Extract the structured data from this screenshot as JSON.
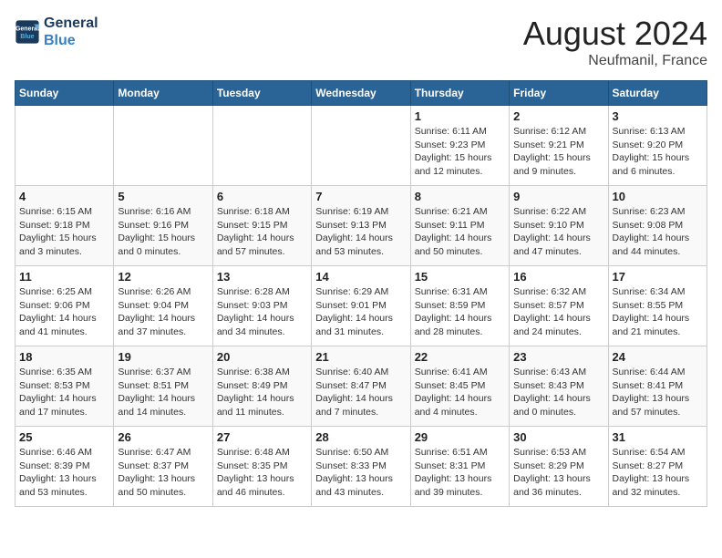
{
  "header": {
    "logo_line1": "General",
    "logo_line2": "Blue",
    "title": "August 2024",
    "subtitle": "Neufmanil, France"
  },
  "days_of_week": [
    "Sunday",
    "Monday",
    "Tuesday",
    "Wednesday",
    "Thursday",
    "Friday",
    "Saturday"
  ],
  "weeks": [
    [
      {
        "day": "",
        "info": ""
      },
      {
        "day": "",
        "info": ""
      },
      {
        "day": "",
        "info": ""
      },
      {
        "day": "",
        "info": ""
      },
      {
        "day": "1",
        "info": "Sunrise: 6:11 AM\nSunset: 9:23 PM\nDaylight: 15 hours\nand 12 minutes."
      },
      {
        "day": "2",
        "info": "Sunrise: 6:12 AM\nSunset: 9:21 PM\nDaylight: 15 hours\nand 9 minutes."
      },
      {
        "day": "3",
        "info": "Sunrise: 6:13 AM\nSunset: 9:20 PM\nDaylight: 15 hours\nand 6 minutes."
      }
    ],
    [
      {
        "day": "4",
        "info": "Sunrise: 6:15 AM\nSunset: 9:18 PM\nDaylight: 15 hours\nand 3 minutes."
      },
      {
        "day": "5",
        "info": "Sunrise: 6:16 AM\nSunset: 9:16 PM\nDaylight: 15 hours\nand 0 minutes."
      },
      {
        "day": "6",
        "info": "Sunrise: 6:18 AM\nSunset: 9:15 PM\nDaylight: 14 hours\nand 57 minutes."
      },
      {
        "day": "7",
        "info": "Sunrise: 6:19 AM\nSunset: 9:13 PM\nDaylight: 14 hours\nand 53 minutes."
      },
      {
        "day": "8",
        "info": "Sunrise: 6:21 AM\nSunset: 9:11 PM\nDaylight: 14 hours\nand 50 minutes."
      },
      {
        "day": "9",
        "info": "Sunrise: 6:22 AM\nSunset: 9:10 PM\nDaylight: 14 hours\nand 47 minutes."
      },
      {
        "day": "10",
        "info": "Sunrise: 6:23 AM\nSunset: 9:08 PM\nDaylight: 14 hours\nand 44 minutes."
      }
    ],
    [
      {
        "day": "11",
        "info": "Sunrise: 6:25 AM\nSunset: 9:06 PM\nDaylight: 14 hours\nand 41 minutes."
      },
      {
        "day": "12",
        "info": "Sunrise: 6:26 AM\nSunset: 9:04 PM\nDaylight: 14 hours\nand 37 minutes."
      },
      {
        "day": "13",
        "info": "Sunrise: 6:28 AM\nSunset: 9:03 PM\nDaylight: 14 hours\nand 34 minutes."
      },
      {
        "day": "14",
        "info": "Sunrise: 6:29 AM\nSunset: 9:01 PM\nDaylight: 14 hours\nand 31 minutes."
      },
      {
        "day": "15",
        "info": "Sunrise: 6:31 AM\nSunset: 8:59 PM\nDaylight: 14 hours\nand 28 minutes."
      },
      {
        "day": "16",
        "info": "Sunrise: 6:32 AM\nSunset: 8:57 PM\nDaylight: 14 hours\nand 24 minutes."
      },
      {
        "day": "17",
        "info": "Sunrise: 6:34 AM\nSunset: 8:55 PM\nDaylight: 14 hours\nand 21 minutes."
      }
    ],
    [
      {
        "day": "18",
        "info": "Sunrise: 6:35 AM\nSunset: 8:53 PM\nDaylight: 14 hours\nand 17 minutes."
      },
      {
        "day": "19",
        "info": "Sunrise: 6:37 AM\nSunset: 8:51 PM\nDaylight: 14 hours\nand 14 minutes."
      },
      {
        "day": "20",
        "info": "Sunrise: 6:38 AM\nSunset: 8:49 PM\nDaylight: 14 hours\nand 11 minutes."
      },
      {
        "day": "21",
        "info": "Sunrise: 6:40 AM\nSunset: 8:47 PM\nDaylight: 14 hours\nand 7 minutes."
      },
      {
        "day": "22",
        "info": "Sunrise: 6:41 AM\nSunset: 8:45 PM\nDaylight: 14 hours\nand 4 minutes."
      },
      {
        "day": "23",
        "info": "Sunrise: 6:43 AM\nSunset: 8:43 PM\nDaylight: 14 hours\nand 0 minutes."
      },
      {
        "day": "24",
        "info": "Sunrise: 6:44 AM\nSunset: 8:41 PM\nDaylight: 13 hours\nand 57 minutes."
      }
    ],
    [
      {
        "day": "25",
        "info": "Sunrise: 6:46 AM\nSunset: 8:39 PM\nDaylight: 13 hours\nand 53 minutes."
      },
      {
        "day": "26",
        "info": "Sunrise: 6:47 AM\nSunset: 8:37 PM\nDaylight: 13 hours\nand 50 minutes."
      },
      {
        "day": "27",
        "info": "Sunrise: 6:48 AM\nSunset: 8:35 PM\nDaylight: 13 hours\nand 46 minutes."
      },
      {
        "day": "28",
        "info": "Sunrise: 6:50 AM\nSunset: 8:33 PM\nDaylight: 13 hours\nand 43 minutes."
      },
      {
        "day": "29",
        "info": "Sunrise: 6:51 AM\nSunset: 8:31 PM\nDaylight: 13 hours\nand 39 minutes."
      },
      {
        "day": "30",
        "info": "Sunrise: 6:53 AM\nSunset: 8:29 PM\nDaylight: 13 hours\nand 36 minutes."
      },
      {
        "day": "31",
        "info": "Sunrise: 6:54 AM\nSunset: 8:27 PM\nDaylight: 13 hours\nand 32 minutes."
      }
    ]
  ]
}
